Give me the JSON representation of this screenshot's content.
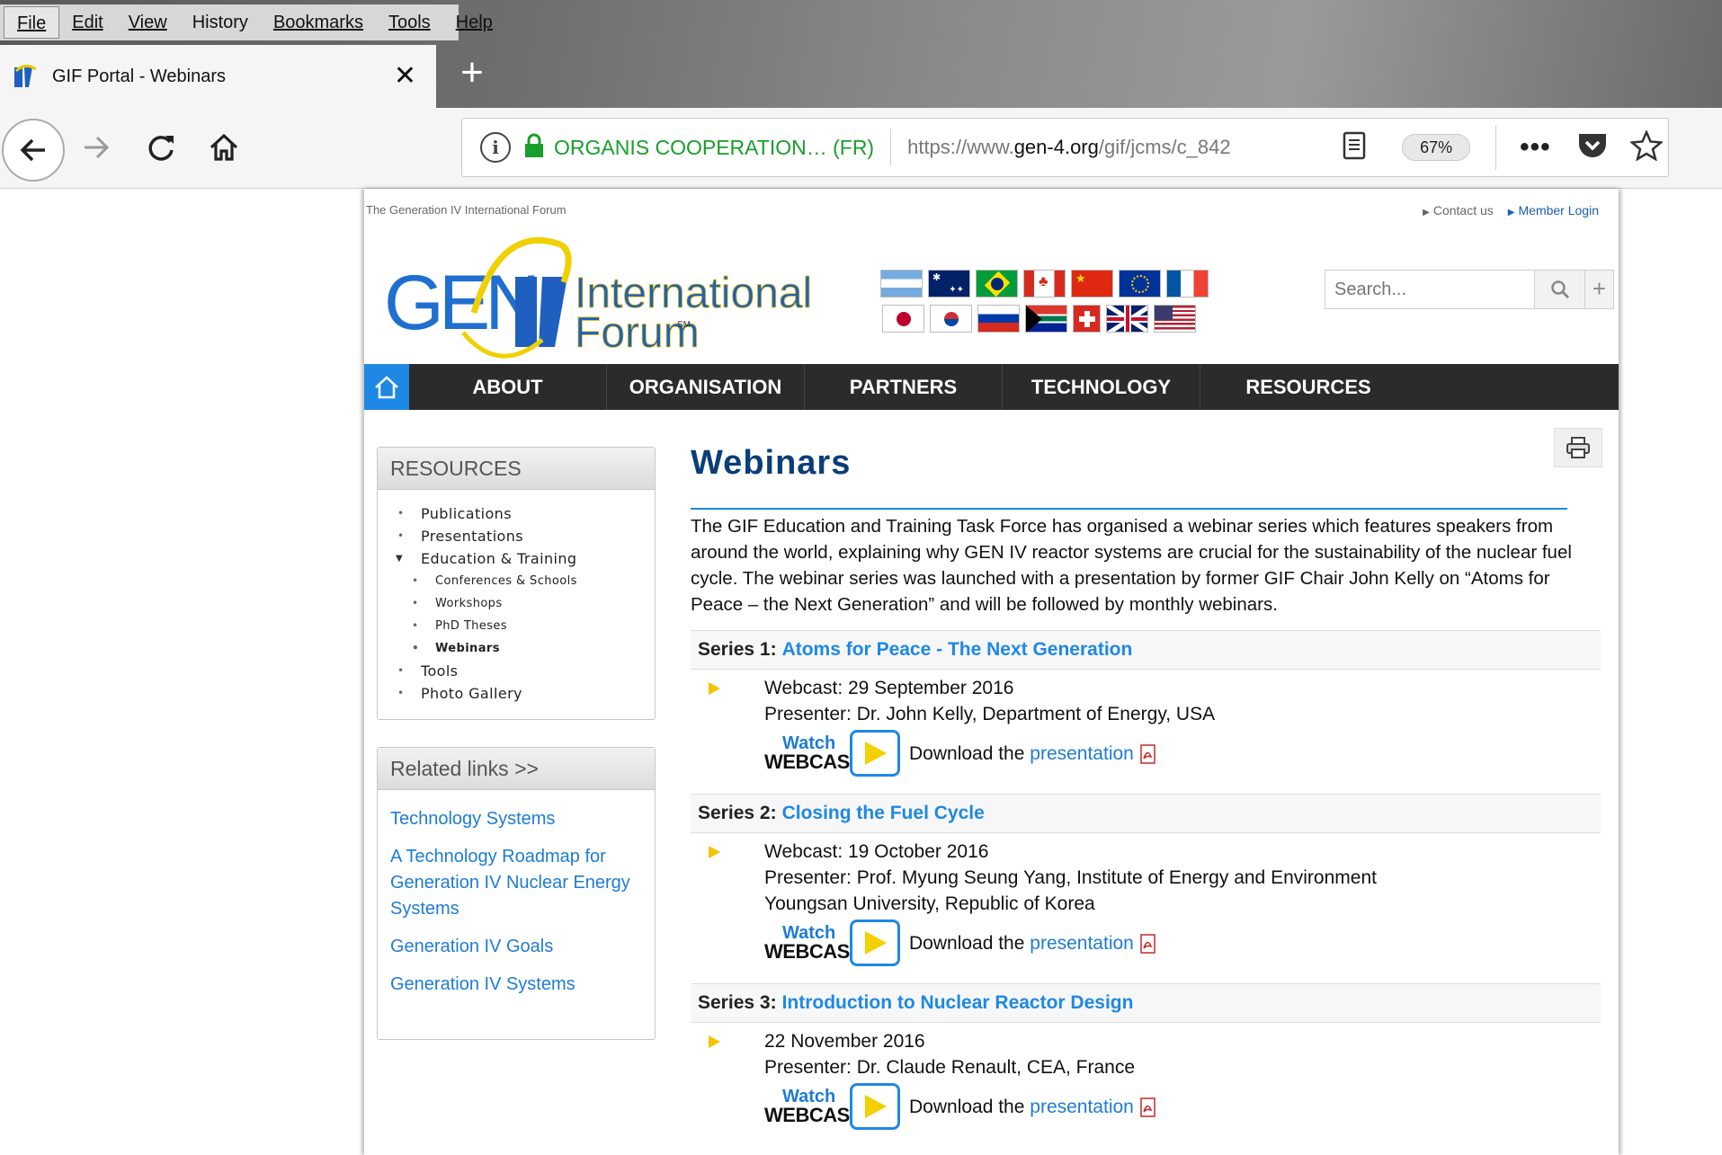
{
  "browser": {
    "menu": [
      {
        "label": "File"
      },
      {
        "label": "Edit"
      },
      {
        "label": "View"
      },
      {
        "label": "History"
      },
      {
        "label": "Bookmarks"
      },
      {
        "label": "Tools"
      },
      {
        "label": "Help"
      }
    ],
    "tab_title": "GIF Portal - Webinars",
    "url_org": "ORGANIS COOPERATION… (FR)",
    "url_prefix": "https://www.",
    "url_domain": "gen-4.org",
    "url_path": "/gif/jcms/c_842",
    "zoom": "67%"
  },
  "site": {
    "tagline": "The Generation IV International Forum",
    "contact": "Contact us",
    "member_login": "Member Login",
    "logo_gen": "GEN",
    "logo_iv": "IV",
    "logo_international": "International",
    "logo_forum": "Forum",
    "logo_sm": "SM",
    "search_placeholder": "Search...",
    "plus": "+",
    "nav": [
      "ABOUT",
      "ORGANISATION",
      "PARTNERS",
      "TECHNOLOGY",
      "RESOURCES"
    ]
  },
  "sidebar": {
    "resources_title": "RESOURCES",
    "items": [
      "Publications",
      "Presentations",
      "Education & Training",
      "Conferences & Schools",
      "Workshops",
      "PhD Theses",
      "Webinars",
      "Tools",
      "Photo Gallery"
    ],
    "related_title": "Related links >>",
    "related": [
      "Technology Systems",
      "A Technology Roadmap for Generation IV Nuclear Energy Systems",
      "Generation IV Goals",
      "Generation IV Systems"
    ]
  },
  "main": {
    "title": "Webinars",
    "intro": "The GIF Education and Training Task Force has organised a webinar series which features speakers from around the world, explaining why GEN IV reactor systems are crucial for the sustainability of the nuclear fuel cycle. The webinar series was launched with a presentation by former GIF Chair John Kelly on “Atoms for Peace – the Next Generation” and will be followed by monthly webinars.",
    "watch_1": "Watch",
    "watch_2": "WEBCAST",
    "download_prefix": "Download the",
    "download_link": "presentation",
    "series": [
      {
        "label": "Series 1:",
        "title": "Atoms for Peace - The Next Generation",
        "date": "Webcast: 29 September 2016",
        "presenter": "Presenter: Dr. John Kelly, Department of Energy, USA",
        "presenter_2": ""
      },
      {
        "label": "Series 2:",
        "title": "Closing the Fuel Cycle",
        "date": "Webcast: 19 October 2016",
        "presenter": "Presenter: Prof. Myung Seung Yang, Institute of Energy and Environment",
        "presenter_2": "Youngsan University, Republic of Korea"
      },
      {
        "label": "Series 3:",
        "title": "Introduction to Nuclear Reactor Design",
        "date": "22 November 2016",
        "presenter": "Presenter: Dr. Claude Renault, CEA, France",
        "presenter_2": ""
      }
    ]
  },
  "colors": {
    "accent": "#1e88e5",
    "title": "#0b3e78",
    "nav_bg": "#2b2b2b",
    "link": "#1e7bd6",
    "secure": "#1a9e2c"
  }
}
